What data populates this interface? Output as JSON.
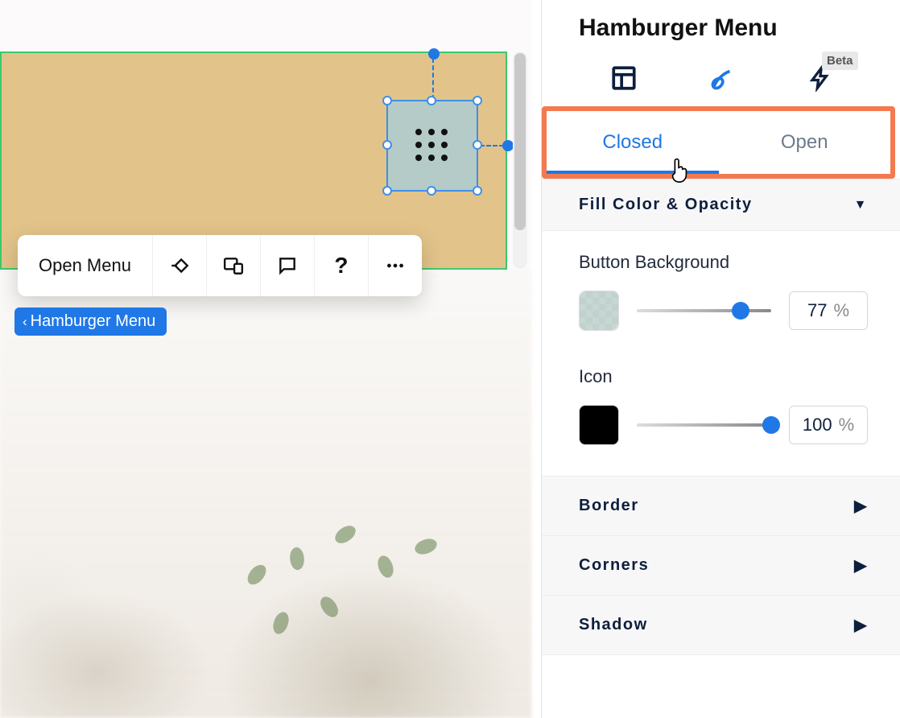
{
  "panel": {
    "title": "Hamburger Menu",
    "beta_label": "Beta",
    "tabs": {
      "closed": "Closed",
      "open": "Open",
      "active": "closed"
    },
    "fill_section": {
      "title": "Fill Color & Opacity",
      "button_bg": {
        "label": "Button Background",
        "opacity_value": "77",
        "opacity_unit": "%",
        "slider_pct": 77,
        "swatch_color": "#b5cbc7"
      },
      "icon_group": {
        "label": "Icon",
        "opacity_value": "100",
        "opacity_unit": "%",
        "slider_pct": 100,
        "swatch_color": "#000000"
      }
    },
    "collapsed_sections": [
      "Border",
      "Corners",
      "Shadow"
    ]
  },
  "canvas": {
    "toolbar": {
      "open_menu_label": "Open Menu"
    },
    "breadcrumb": "Hamburger Menu"
  }
}
